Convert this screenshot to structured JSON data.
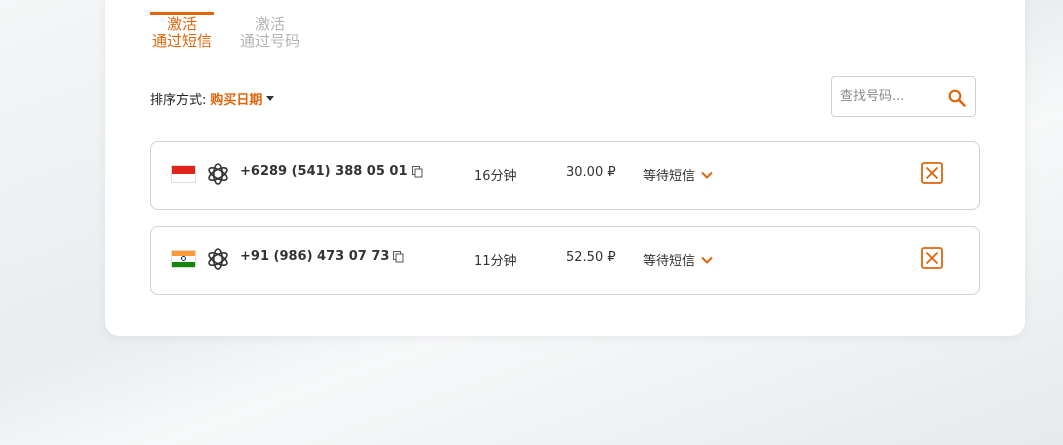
{
  "tabs": [
    {
      "line1": "激活",
      "line2": "通过短信",
      "active": true
    },
    {
      "line1": "激活",
      "line2": "通过号码",
      "active": false
    }
  ],
  "sort": {
    "label": "排序方式:",
    "value": "购买日期"
  },
  "search": {
    "placeholder": "查找号码..."
  },
  "rows": [
    {
      "country": "Indonesia",
      "service": "openai-icon",
      "phone": "+6289 (541) 388 05 01",
      "time": "16分钟",
      "price": "30.00 ₽",
      "status": "等待短信"
    },
    {
      "country": "India",
      "service": "openai-icon",
      "phone": "+91 (986) 473 07 73",
      "time": "11分钟",
      "price": "52.50 ₽",
      "status": "等待短信"
    }
  ],
  "colors": {
    "accent": "#e0650b",
    "border": "#cfd3d6",
    "inactive_tab": "#b4b4b4"
  }
}
